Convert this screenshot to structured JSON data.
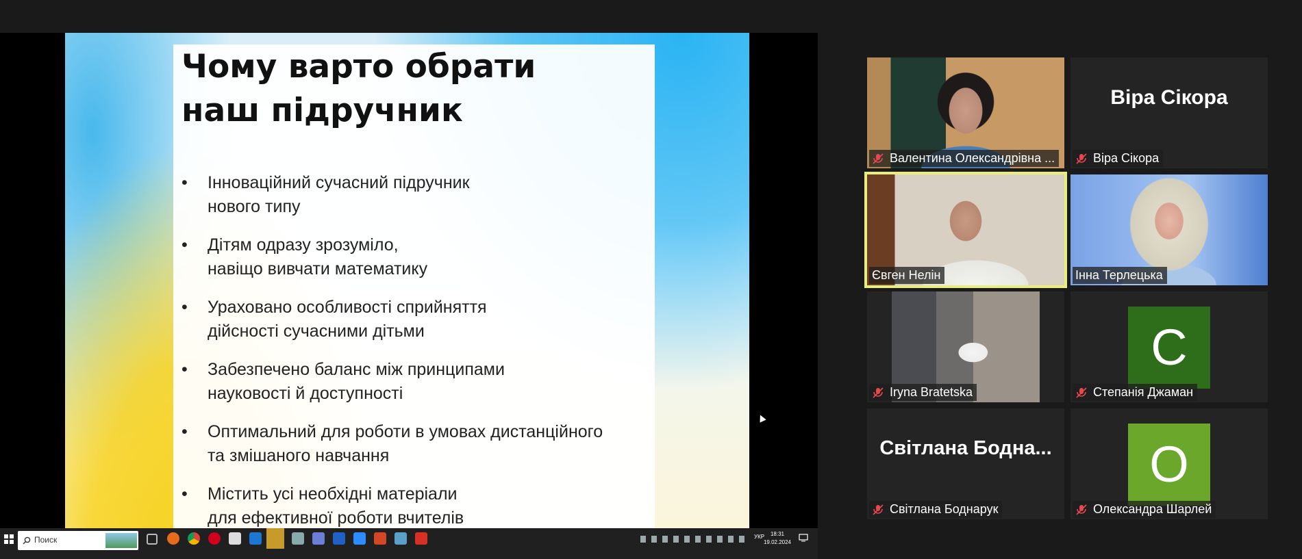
{
  "slide": {
    "title": "Чому варто обрати\nнаш підручник",
    "bullet_symbol": "•",
    "bullets": [
      "Інноваційний сучасний підручник\nнового типу",
      "Дітям одразу зрозуміло,\nнавіщо вивчати математику",
      "Ураховано особливості сприйняття\nдійсності сучасними дітьми",
      "Забезпечено баланс між принципами\nнауковості й доступності",
      "Оптимальний для роботи в умовах дистанційного\nта змішаного навчання",
      "Містить усі необхідні матеріали\nдля ефективної роботи вчителів"
    ]
  },
  "participants": [
    {
      "name": "Валентина Олександрівна ...",
      "muted": true,
      "video": true
    },
    {
      "name": "Віра Сікора",
      "card": "Віра Сікора",
      "muted": true,
      "video": false
    },
    {
      "name": "Євген Нелін",
      "muted": false,
      "video": true,
      "speaking": true
    },
    {
      "name": "Інна Терлецька",
      "muted": false,
      "video": true
    },
    {
      "name": "Iryna Bratetska",
      "muted": true,
      "video": true
    },
    {
      "name": "Степанія Джаман",
      "avatar": "С",
      "avatar_color": "#2e6d1a",
      "muted": true,
      "video": false
    },
    {
      "name": "Світлана Боднарук",
      "card": "Світлана  Бодна...",
      "muted": true,
      "video": false
    },
    {
      "name": "Олександра Шарлей",
      "avatar": "О",
      "avatar_color": "#6aa72a",
      "muted": true,
      "video": false
    }
  ],
  "taskbar": {
    "search_placeholder": "Поиск",
    "language": "УКР",
    "time": "18:31",
    "date": "19.02.2024"
  },
  "colors": {
    "speaking_outline": "#e9ed7c",
    "mute_icon": "#e5484d",
    "tile_bg": "#242424"
  }
}
